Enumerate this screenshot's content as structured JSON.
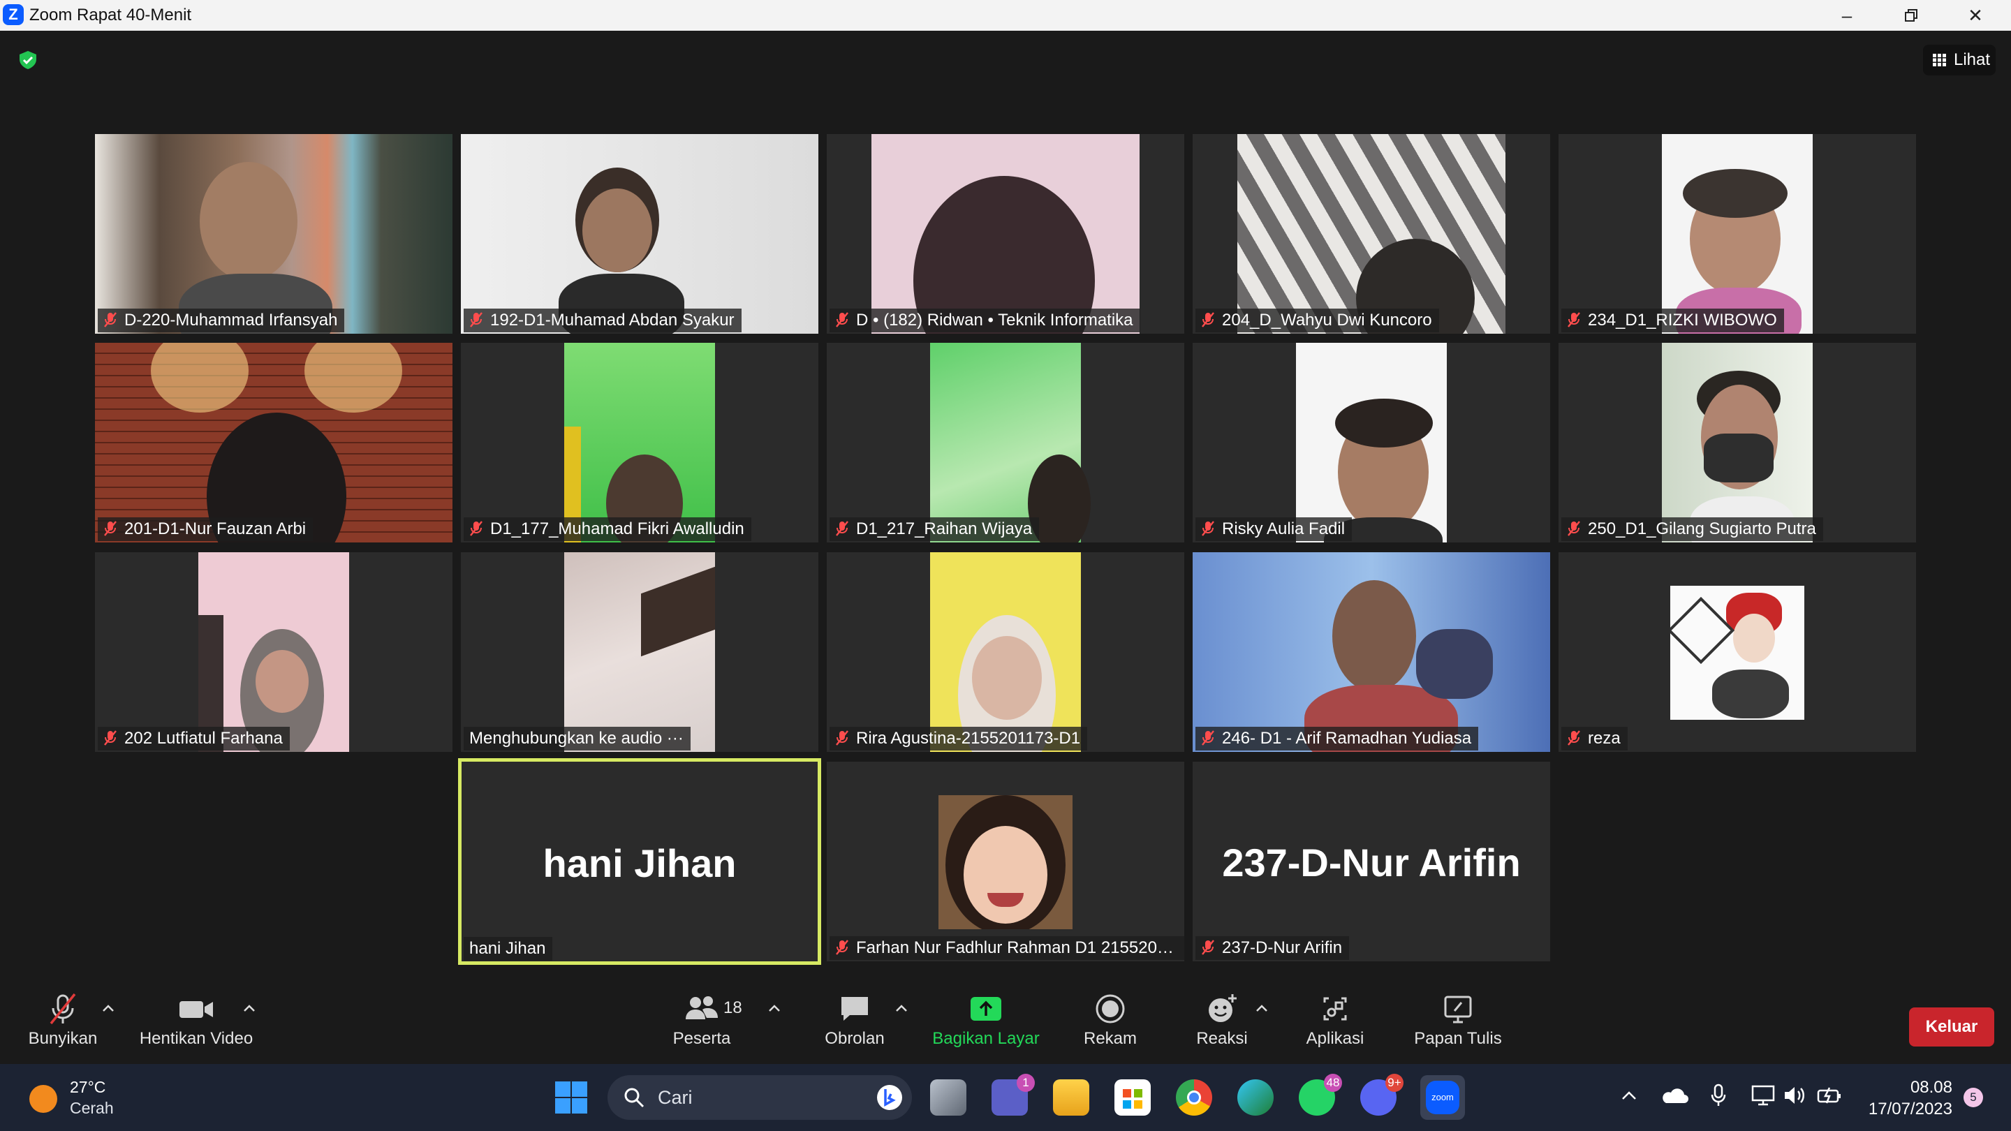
{
  "window": {
    "title": "Zoom Rapat 40-Menit",
    "view_label": "Lihat"
  },
  "participants": [
    {
      "name": "D-220-Muhammad Irfansyah",
      "muted": true
    },
    {
      "name": "192-D1-Muhamad Abdan Syakur",
      "muted": true
    },
    {
      "name": "D • (182) Ridwan • Teknik Informatika",
      "muted": true
    },
    {
      "name": "204_D_Wahyu Dwi Kuncoro",
      "muted": true
    },
    {
      "name": "234_D1_RIZKI WIBOWO",
      "muted": true
    },
    {
      "name": "201-D1-Nur Fauzan Arbi",
      "muted": true
    },
    {
      "name": "D1_177_Muhamad Fikri Awalludin",
      "muted": true
    },
    {
      "name": "D1_217_Raihan Wijaya",
      "muted": true
    },
    {
      "name": "Risky Aulia Fadil",
      "muted": true
    },
    {
      "name": "250_D1_Gilang Sugiarto Putra",
      "muted": true
    },
    {
      "name": "202 Lutfiatul Farhana",
      "muted": true
    },
    {
      "name": "Menghubungkan ke audio ···",
      "muted": false
    },
    {
      "name": "Rira Agustina-2155201173-D1",
      "muted": true
    },
    {
      "name": "246- D1 - Arif Ramadhan Yudiasa",
      "muted": true
    },
    {
      "name": "reza",
      "muted": true
    },
    {
      "name": "hani Jihan",
      "muted": false,
      "big_name": "hani Jihan",
      "active_speaker": true
    },
    {
      "name": "Farhan Nur Fadhlur Rahman D1 21552011...",
      "muted": true
    },
    {
      "name": "237-D-Nur Arifin",
      "muted": true,
      "big_name": "237-D-Nur Arifin"
    }
  ],
  "toolbar": {
    "unmute_label": "Bunyikan",
    "stop_video_label": "Hentikan Video",
    "participants_label": "Peserta",
    "participants_count": "18",
    "chat_label": "Obrolan",
    "share_label": "Bagikan Layar",
    "record_label": "Rekam",
    "reactions_label": "Reaksi",
    "apps_label": "Aplikasi",
    "whiteboard_label": "Papan Tulis",
    "leave_label": "Keluar",
    "share_color": "#23d959",
    "leave_color": "#c9252c"
  },
  "taskbar": {
    "temperature": "27°C",
    "weather": "Cerah",
    "search_label": "Cari",
    "teams_badge": "1",
    "whatsapp_badge": "48",
    "discord_badge": "9+",
    "time": "08.08",
    "date": "17/07/2023",
    "notification_count": "5"
  }
}
